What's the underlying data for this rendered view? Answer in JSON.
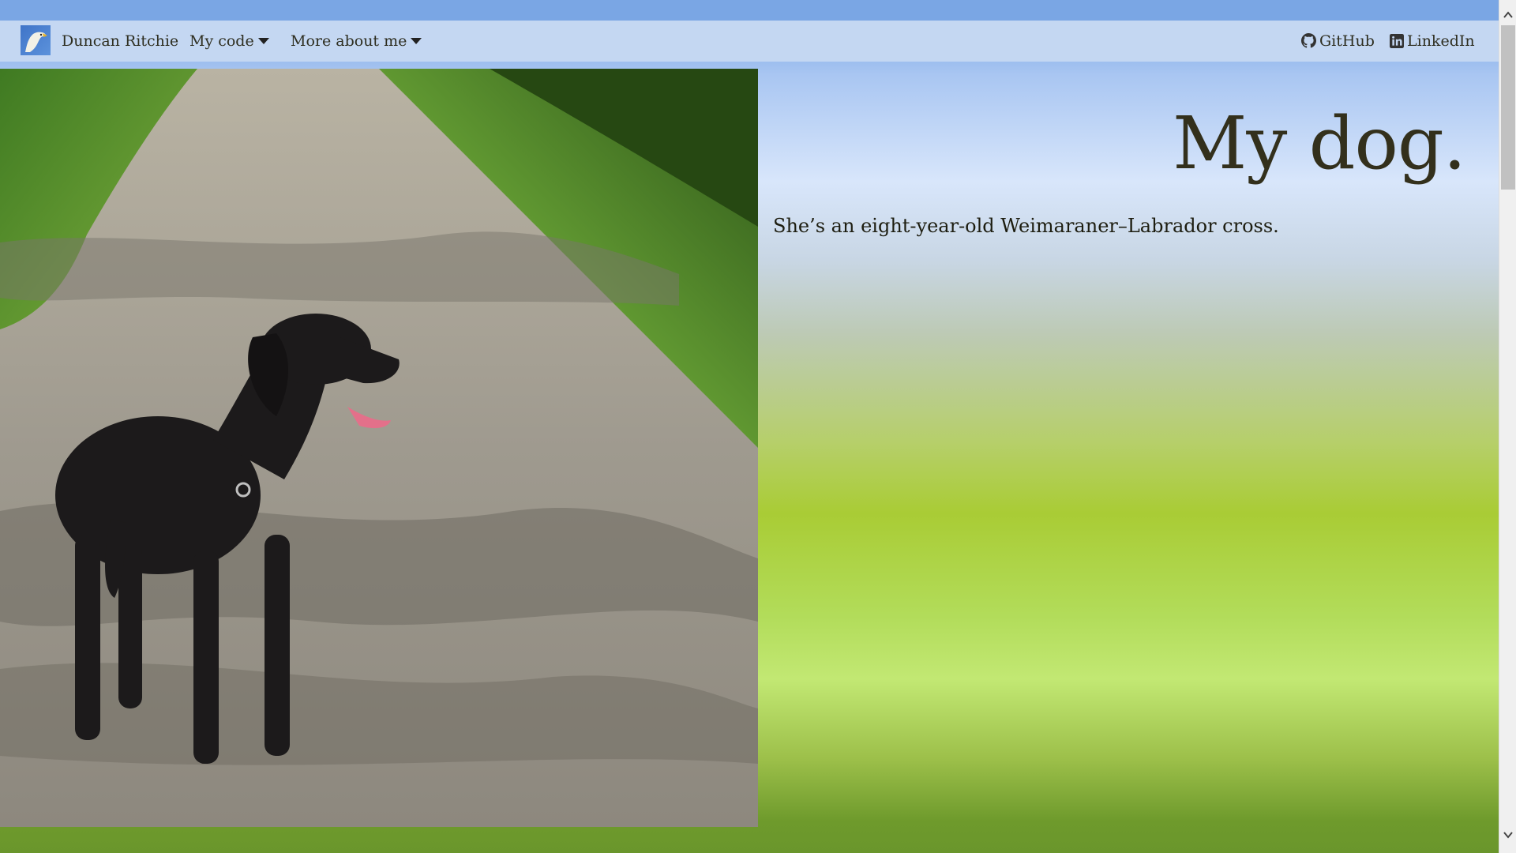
{
  "navbar": {
    "brand_name": "Duncan Ritchie",
    "menu_code": "My code",
    "menu_about": "More about me",
    "link_github": "GitHub",
    "link_linkedin": "LinkedIn"
  },
  "main": {
    "title": "My dog.",
    "description": "She’s an eight-year-old Weimaraner–Labrador cross."
  },
  "icons": {
    "logo": "eagle-logo-icon",
    "code_menu": "caret-down-icon",
    "about_menu": "caret-down-icon",
    "github": "github-icon",
    "linkedin": "linkedin-icon",
    "scroll_up": "chevron-up-icon",
    "scroll_down": "chevron-down-icon"
  },
  "colors": {
    "navbar_bg": "#c4d7f2",
    "text": "#2e2e20",
    "title": "#33301c",
    "sky_top": "#7aa6e4",
    "grass": "#a9cc35"
  }
}
